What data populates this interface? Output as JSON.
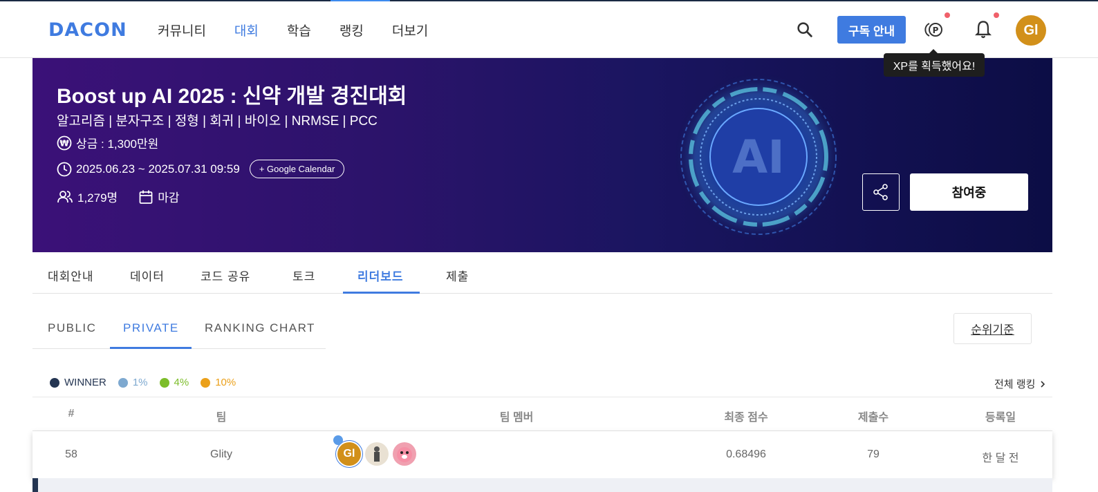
{
  "header": {
    "logo": "DACON",
    "nav": [
      "커뮤니티",
      "대회",
      "학습",
      "랭킹",
      "더보기"
    ],
    "subscribe_label": "구독 안내",
    "avatar_initials": "Gl",
    "tooltip": "XP를 획득했어요!"
  },
  "banner": {
    "title": "Boost up AI 2025 : 신약 개발 경진대회",
    "tags": "알고리즘 | 분자구조 | 정형 | 회귀 | 바이오 | NRMSE | PCC",
    "prize": "상금 : 1,300만원",
    "period": "2025.06.23 ~ 2025.07.31 09:59",
    "gcal_label": "+ Google Calendar",
    "participants": "1,279명",
    "status": "마감",
    "art_text": "AI",
    "join_label": "참여중"
  },
  "tabs": [
    "대회안내",
    "데이터",
    "코드 공유",
    "토크",
    "리더보드",
    "제출"
  ],
  "subtabs": [
    "PUBLIC",
    "PRIVATE",
    "RANKING CHART"
  ],
  "rank_basis_label": "순위기준",
  "legend": [
    {
      "label": "WINNER",
      "color": "#243552"
    },
    {
      "label": "1%",
      "color": "#7ea9d0"
    },
    {
      "label": "4%",
      "color": "#7cbd2a"
    },
    {
      "label": "10%",
      "color": "#eba01a"
    }
  ],
  "full_rank_label": "전체 랭킹",
  "table": {
    "headers": [
      "#",
      "팀",
      "팀 멤버",
      "최종 점수",
      "제출수",
      "등록일"
    ],
    "row": {
      "rank": "58",
      "team": "Glity",
      "member_initials": "Gl",
      "score": "0.68496",
      "submissions": "79",
      "registered": "한 달 전"
    }
  }
}
